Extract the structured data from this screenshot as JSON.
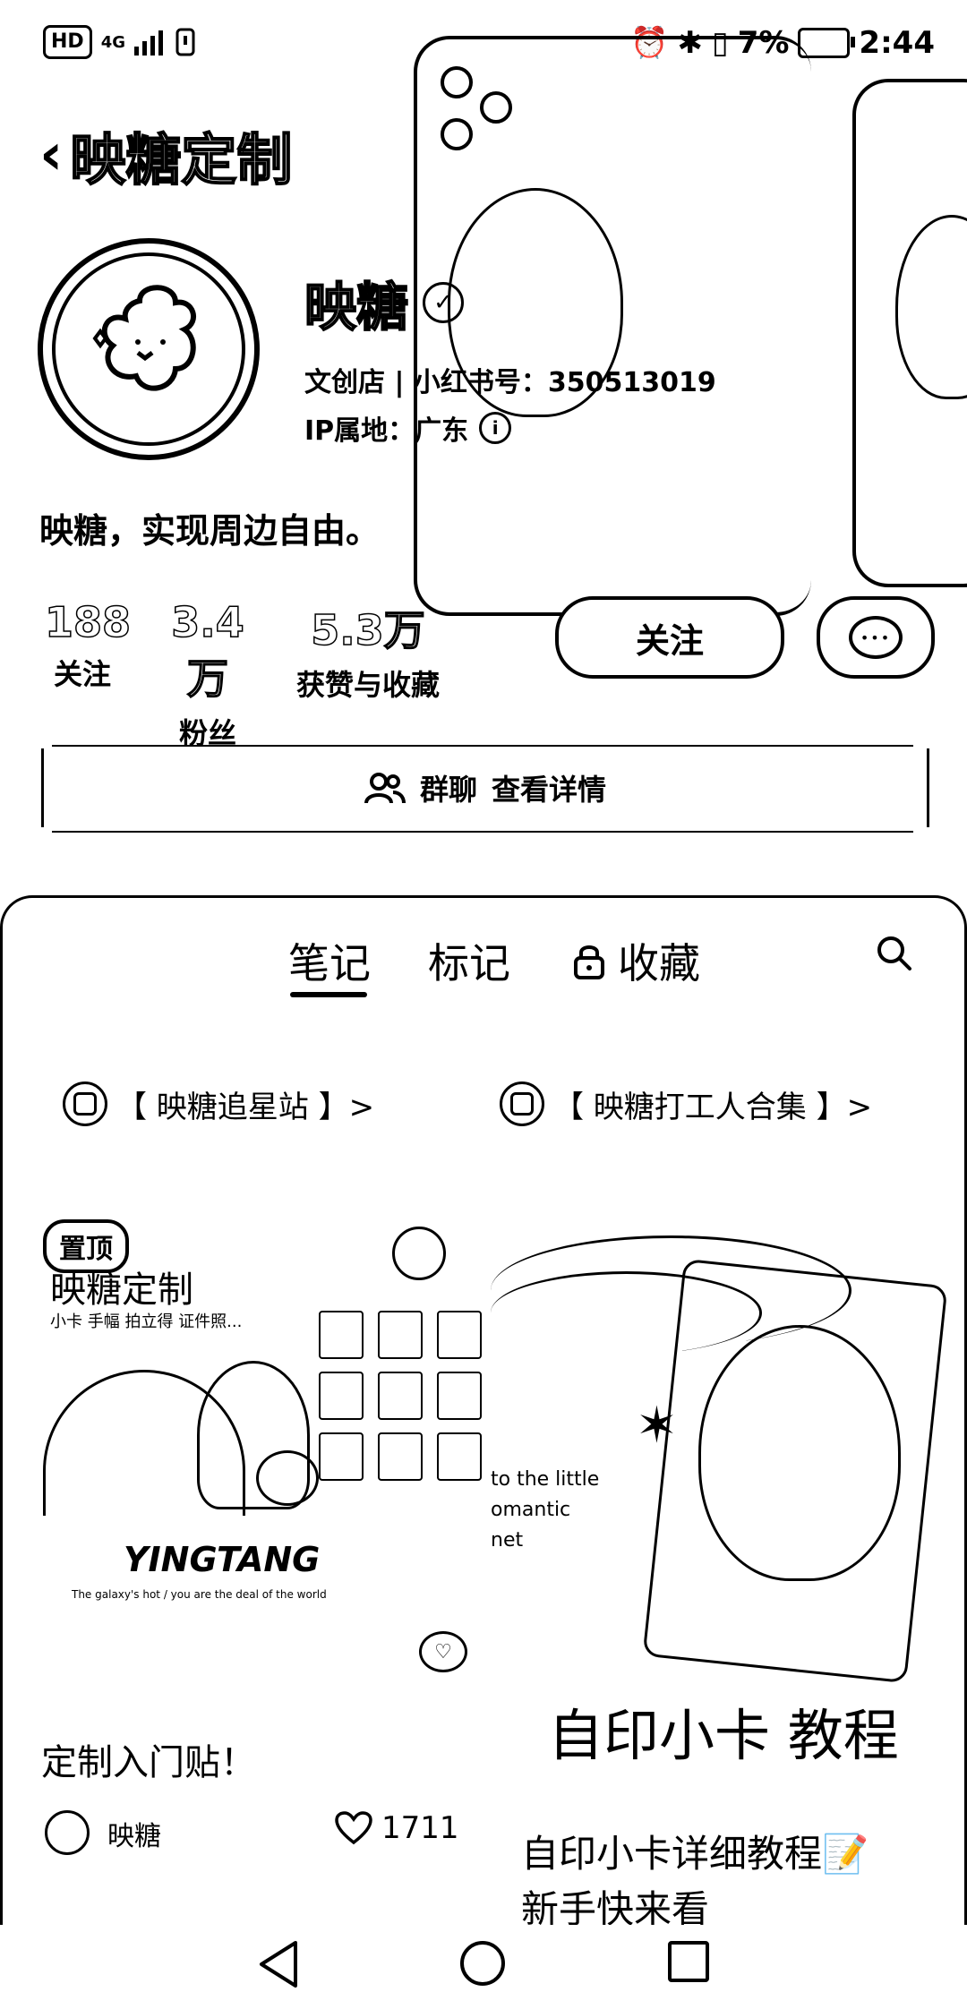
{
  "status_bar": {
    "hd_label": "HD",
    "signal": "4G",
    "battery_percent": "7%",
    "time": "2:44"
  },
  "header": {
    "title": "映糖定制",
    "name": "映糖",
    "shop_info": "文创店 | 小红书号：350513019",
    "ip_location": "IP属地：广东",
    "bio": "映糖，实现周边自由。"
  },
  "stats": [
    {
      "value": "188",
      "label": "关注"
    },
    {
      "value": "3.4万",
      "label": "粉丝"
    },
    {
      "value": "5.3万",
      "label": "获赞与收藏"
    }
  ],
  "actions": {
    "follow_label": "关注",
    "group_chat_label": "群聊",
    "group_detail_label": "查看详情"
  },
  "tabs": [
    {
      "label": "笔记",
      "active": true
    },
    {
      "label": "标记",
      "active": false
    },
    {
      "label": "收藏",
      "active": false,
      "locked": true
    }
  ],
  "collections": [
    {
      "label": "【 映糖追星站 】>"
    },
    {
      "label": "【 映糖打工人合集 】>"
    }
  ],
  "card1": {
    "pin_label": "置顶",
    "image_title": "映糖定制",
    "image_subtitle": "小卡 手幅 拍立得 证件照...",
    "image_brand": "YINGTANG",
    "image_small_print": "The galaxy's hot / you are the deal of the world",
    "caption": "定制入门贴！",
    "author": "映糖",
    "likes": "1711"
  },
  "card2": {
    "image_text": "to the little\nomantic\nnet",
    "image_big_text": "自印小卡 教程",
    "caption_line1": "自印小卡详细教程📝",
    "caption_line2": "新手快来看"
  },
  "icons": {
    "back": "chevron-left-icon",
    "verified": "verified-check-icon",
    "info": "info-icon",
    "chat": "message-icon",
    "group": "users-icon",
    "lock": "lock-icon",
    "search": "search-icon",
    "collection": "collection-icon",
    "heart": "heart-icon"
  }
}
